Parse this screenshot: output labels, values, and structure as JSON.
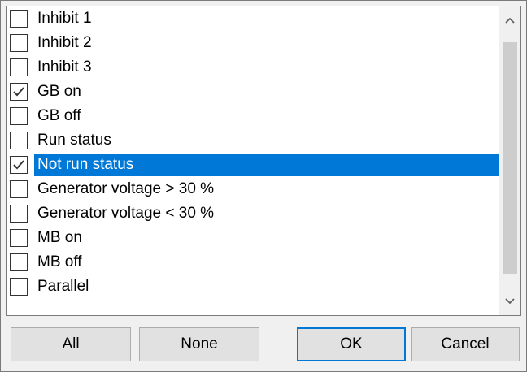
{
  "list": {
    "items": [
      {
        "label": "Inhibit 1",
        "checked": false,
        "selected": false
      },
      {
        "label": "Inhibit 2",
        "checked": false,
        "selected": false
      },
      {
        "label": "Inhibit 3",
        "checked": false,
        "selected": false
      },
      {
        "label": "GB on",
        "checked": true,
        "selected": false
      },
      {
        "label": "GB off",
        "checked": false,
        "selected": false
      },
      {
        "label": "Run status",
        "checked": false,
        "selected": false
      },
      {
        "label": "Not run status",
        "checked": true,
        "selected": true
      },
      {
        "label": "Generator voltage > 30 %",
        "checked": false,
        "selected": false
      },
      {
        "label": "Generator voltage < 30 %",
        "checked": false,
        "selected": false
      },
      {
        "label": "MB on",
        "checked": false,
        "selected": false
      },
      {
        "label": "MB off",
        "checked": false,
        "selected": false
      },
      {
        "label": "Parallel",
        "checked": false,
        "selected": false
      }
    ]
  },
  "scrollbar": {
    "up_icon": "chevron-up-icon",
    "down_icon": "chevron-down-icon"
  },
  "buttons": {
    "all_label": "All",
    "none_label": "None",
    "ok_label": "OK",
    "cancel_label": "Cancel"
  },
  "colors": {
    "selection": "#0078d7",
    "dialog_bg": "#f0f0f0"
  }
}
